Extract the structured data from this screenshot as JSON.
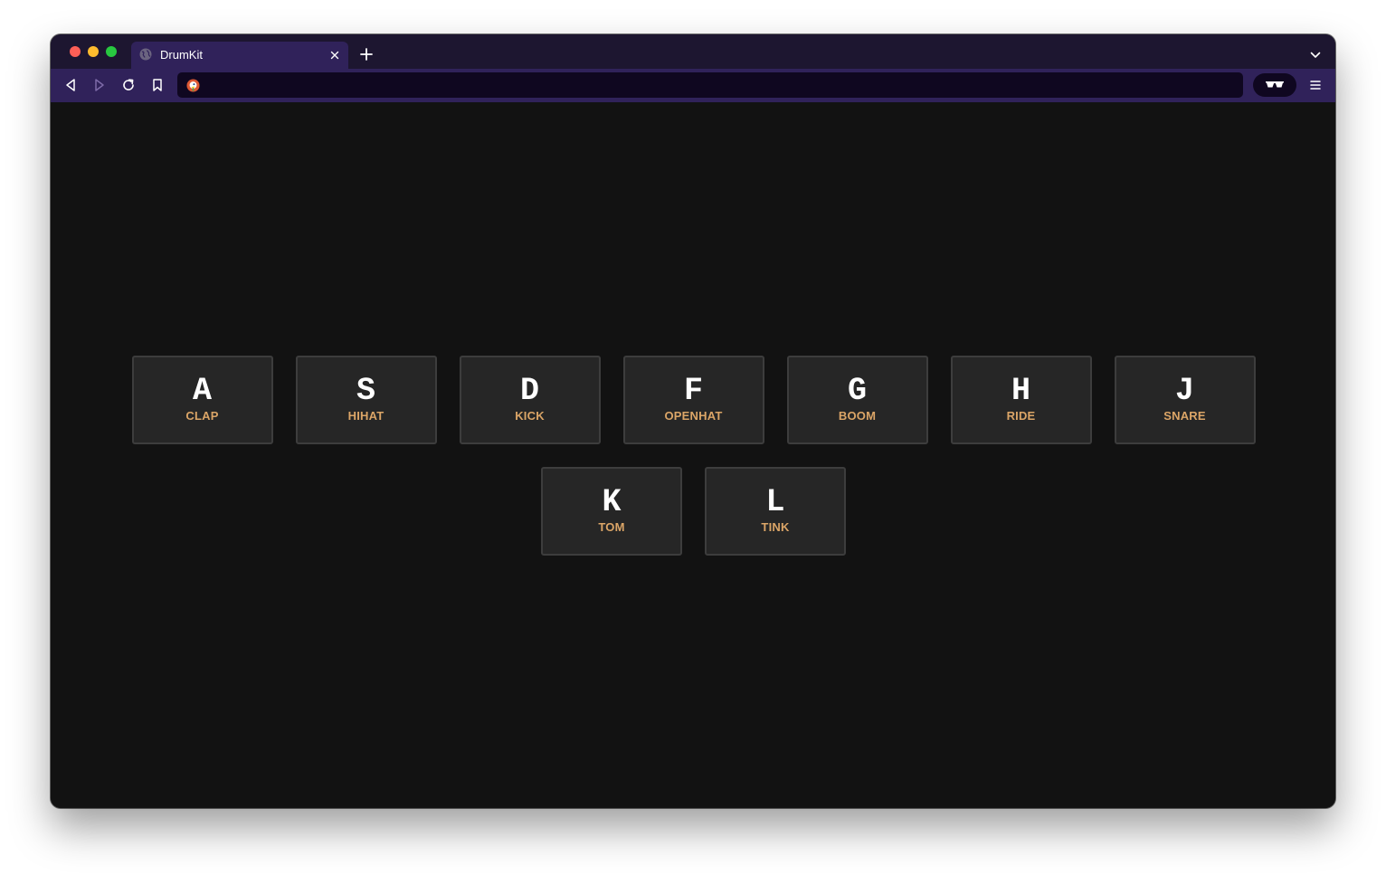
{
  "browser": {
    "tab": {
      "title": "DrumKit",
      "favicon": "globe-icon"
    },
    "address_bar": {
      "value": "",
      "placeholder": "",
      "engine_icon": "duckduckgo-logo"
    },
    "toolbar_icons": [
      "back-icon",
      "forward-icon",
      "reload-icon",
      "bookmark-icon",
      "reader-glasses-icon",
      "menu-icon"
    ],
    "colors": {
      "tab_strip": "#1d1630",
      "toolbar": "#30225a",
      "url_bar": "#0f0720",
      "page_bg": "#121212"
    }
  },
  "drumkit": {
    "keys": [
      {
        "key": "A",
        "sound": "CLAP"
      },
      {
        "key": "S",
        "sound": "HIHAT"
      },
      {
        "key": "D",
        "sound": "KICK"
      },
      {
        "key": "F",
        "sound": "OPENHAT"
      },
      {
        "key": "G",
        "sound": "BOOM"
      },
      {
        "key": "H",
        "sound": "RIDE"
      },
      {
        "key": "J",
        "sound": "SNARE"
      },
      {
        "key": "K",
        "sound": "TOM"
      },
      {
        "key": "L",
        "sound": "TINK"
      }
    ],
    "colors": {
      "key_bg": "#262626",
      "key_border": "#3d3d3d",
      "key_letter": "#ffffff",
      "sound_label": "#dba567"
    }
  }
}
